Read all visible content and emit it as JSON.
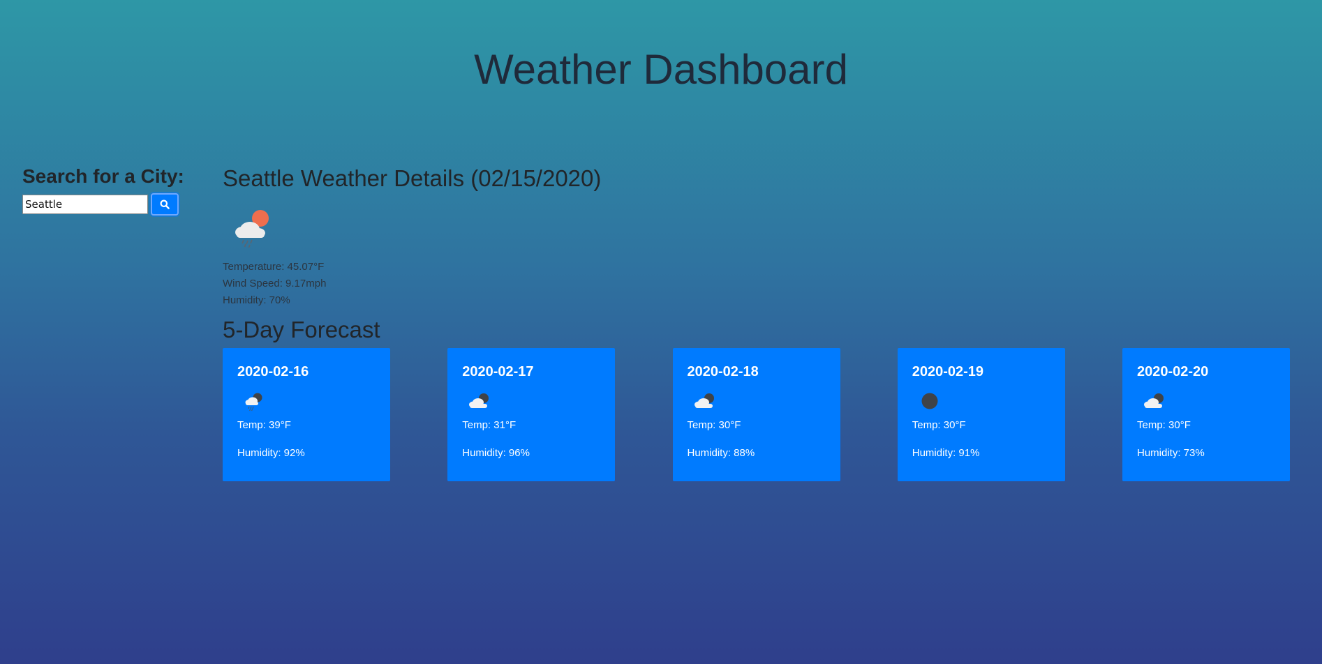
{
  "header": {
    "title": "Weather Dashboard"
  },
  "search": {
    "heading": "Search for a City:",
    "value": "Seattle",
    "button_icon": "search-icon"
  },
  "current": {
    "heading": "Seattle Weather Details (02/15/2020)",
    "icon": "cloud-sun-rain-icon",
    "temperature": "Temperature: 45.07°F",
    "wind": "Wind Speed: 9.17mph",
    "humidity": "Humidity: 70%"
  },
  "forecast": {
    "heading": "5-Day Forecast",
    "days": [
      {
        "date": "2020-02-16",
        "icon": "cloud-rain-night-icon",
        "temp": "Temp: 39°F",
        "humidity": "Humidity: 92%"
      },
      {
        "date": "2020-02-17",
        "icon": "cloud-night-icon",
        "temp": "Temp: 31°F",
        "humidity": "Humidity: 96%"
      },
      {
        "date": "2020-02-18",
        "icon": "cloud-night-icon",
        "temp": "Temp: 30°F",
        "humidity": "Humidity: 88%"
      },
      {
        "date": "2020-02-19",
        "icon": "clear-night-icon",
        "temp": "Temp: 30°F",
        "humidity": "Humidity: 91%"
      },
      {
        "date": "2020-02-20",
        "icon": "cloud-night-icon",
        "temp": "Temp: 30°F",
        "humidity": "Humidity: 73%"
      }
    ]
  },
  "colors": {
    "card_background": "#007bff",
    "button_background": "#007bff",
    "gradient_top": "#2e97a6",
    "gradient_bottom": "#2f3f8c"
  }
}
